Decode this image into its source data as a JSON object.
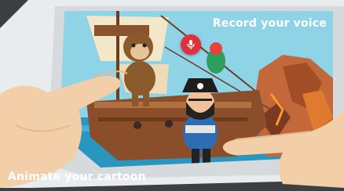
{
  "captions": {
    "top": "Record your voice",
    "bottom": "Animate your cartoon"
  },
  "toolbar": {
    "record_icon": "microphone-icon",
    "record_color": "#e1313a"
  },
  "colors": {
    "background": "#3e3f42",
    "sky": "#8fd3e6",
    "sea": "#2a96bf",
    "device": "#e9ecef"
  }
}
